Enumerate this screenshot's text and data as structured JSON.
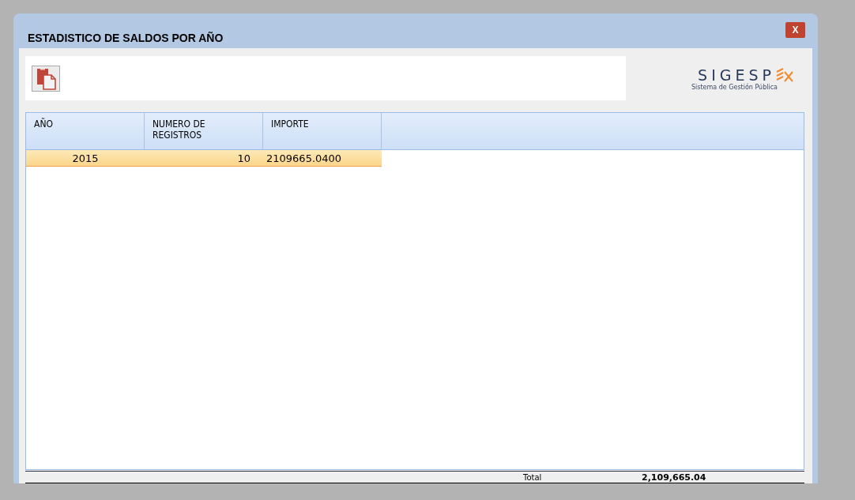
{
  "window": {
    "title": "ESTADISTICO DE SALDOS POR AÑO",
    "close_label": "X"
  },
  "logo": {
    "name": "SIGESP",
    "tagline": "Sistema de Gestión Pública"
  },
  "table": {
    "columns": [
      "AÑO",
      "NUMERO DE REGISTROS",
      "IMPORTE"
    ],
    "rows": [
      {
        "cells": [
          "2015",
          "10",
          "2109665.0400"
        ],
        "selected": true
      }
    ]
  },
  "footer": {
    "label": "Total",
    "value": "2,109,665.04"
  }
}
